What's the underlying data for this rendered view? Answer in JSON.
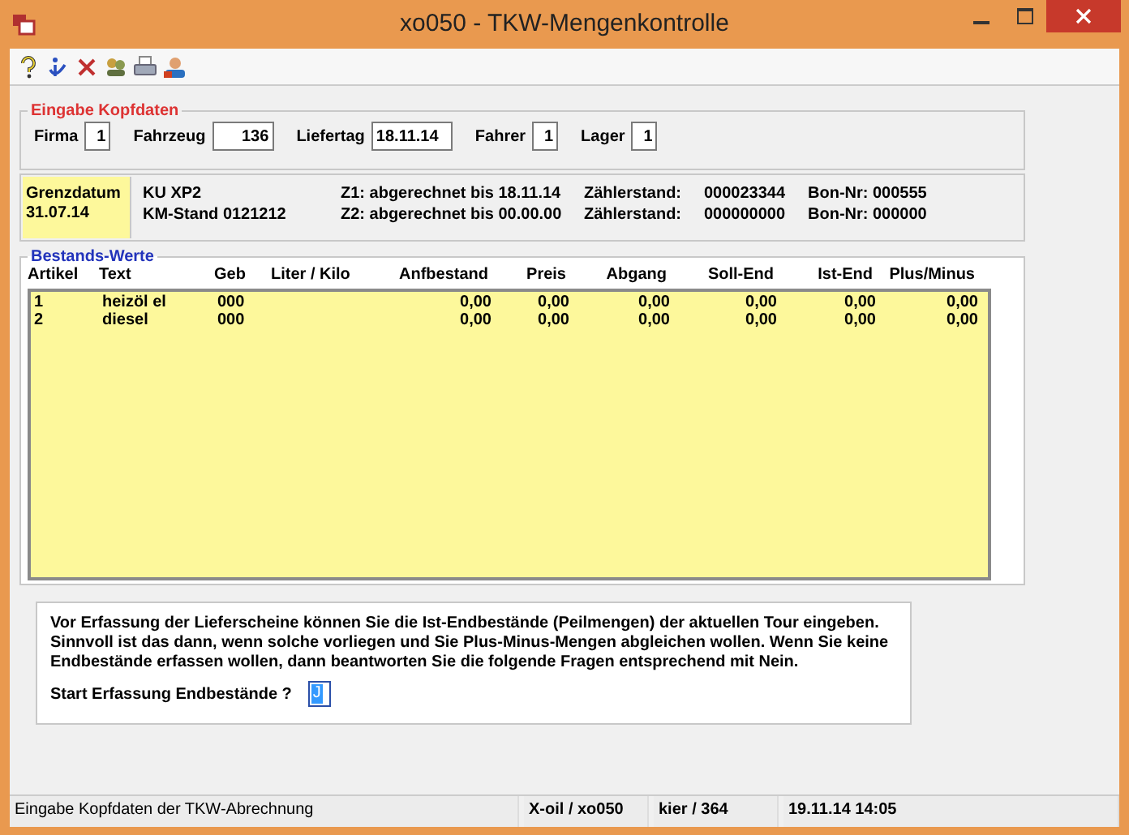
{
  "window": {
    "title": "xo050 - TKW-Mengenkontrolle"
  },
  "header_group": {
    "title": "Eingabe Kopfdaten",
    "fields": [
      {
        "label": "Firma",
        "value": "1",
        "kind": "small"
      },
      {
        "label": "Fahrzeug",
        "value": "136",
        "kind": "wide"
      },
      {
        "label": "Liefertag",
        "value": "18.11.14",
        "kind": "date"
      },
      {
        "label": "Fahrer",
        "value": "1",
        "kind": "small"
      },
      {
        "label": "Lager",
        "value": "1",
        "kind": "small"
      }
    ]
  },
  "info": {
    "limit_label": "Grenzdatum",
    "limit_date": "31.07.14",
    "lines": [
      {
        "vehicle": "KU XP2",
        "status": "Z1: abgerechnet bis 18.11.14",
        "meter_label": "Zählerstand:",
        "meter": "000023344",
        "bon_label": "Bon-Nr:",
        "bon": "000555"
      },
      {
        "vehicle": "KM-Stand 0121212",
        "status": "Z2: abgerechnet bis 00.00.00",
        "meter_label": "Zählerstand:",
        "meter": "000000000",
        "bon_label": "Bon-Nr:",
        "bon": "000000"
      }
    ]
  },
  "stock_group": {
    "title": "Bestands-Werte",
    "columns": [
      "Artikel",
      "Text",
      "Geb",
      "Liter / Kilo",
      "Anfbestand",
      "Preis",
      "Abgang",
      "Soll-End",
      "Ist-End",
      "Plus/Minus"
    ],
    "rows": [
      {
        "artikel": "1",
        "text": "heizöl el",
        "geb": "000",
        "anfbestand": "0,00",
        "preis": "0,00",
        "abgang": "0,00",
        "soll_end": "0,00",
        "ist_end": "0,00",
        "plus_minus": "0,00"
      },
      {
        "artikel": "2",
        "text": "diesel",
        "geb": "000",
        "anfbestand": "0,00",
        "preis": "0,00",
        "abgang": "0,00",
        "soll_end": "0,00",
        "ist_end": "0,00",
        "plus_minus": "0,00"
      }
    ]
  },
  "message": {
    "text": "Vor Erfassung der Lieferscheine können Sie die Ist-Endbestände (Peilmengen) der aktuellen Tour eingeben. Sinnvoll ist das dann, wenn solche vorliegen und Sie Plus-Minus-Mengen abgleichen wollen. Wenn Sie keine Endbestände erfassen wollen, dann beantworten Sie die folgende Fragen entsprechend mit Nein.",
    "question": "Start Erfassung Endbestände ?",
    "answer": "J"
  },
  "status_bar": [
    "Eingabe Kopfdaten der TKW-Abrechnung",
    "X-oil / xo050",
    "kier / 364",
    "19.11.14 14:05"
  ]
}
